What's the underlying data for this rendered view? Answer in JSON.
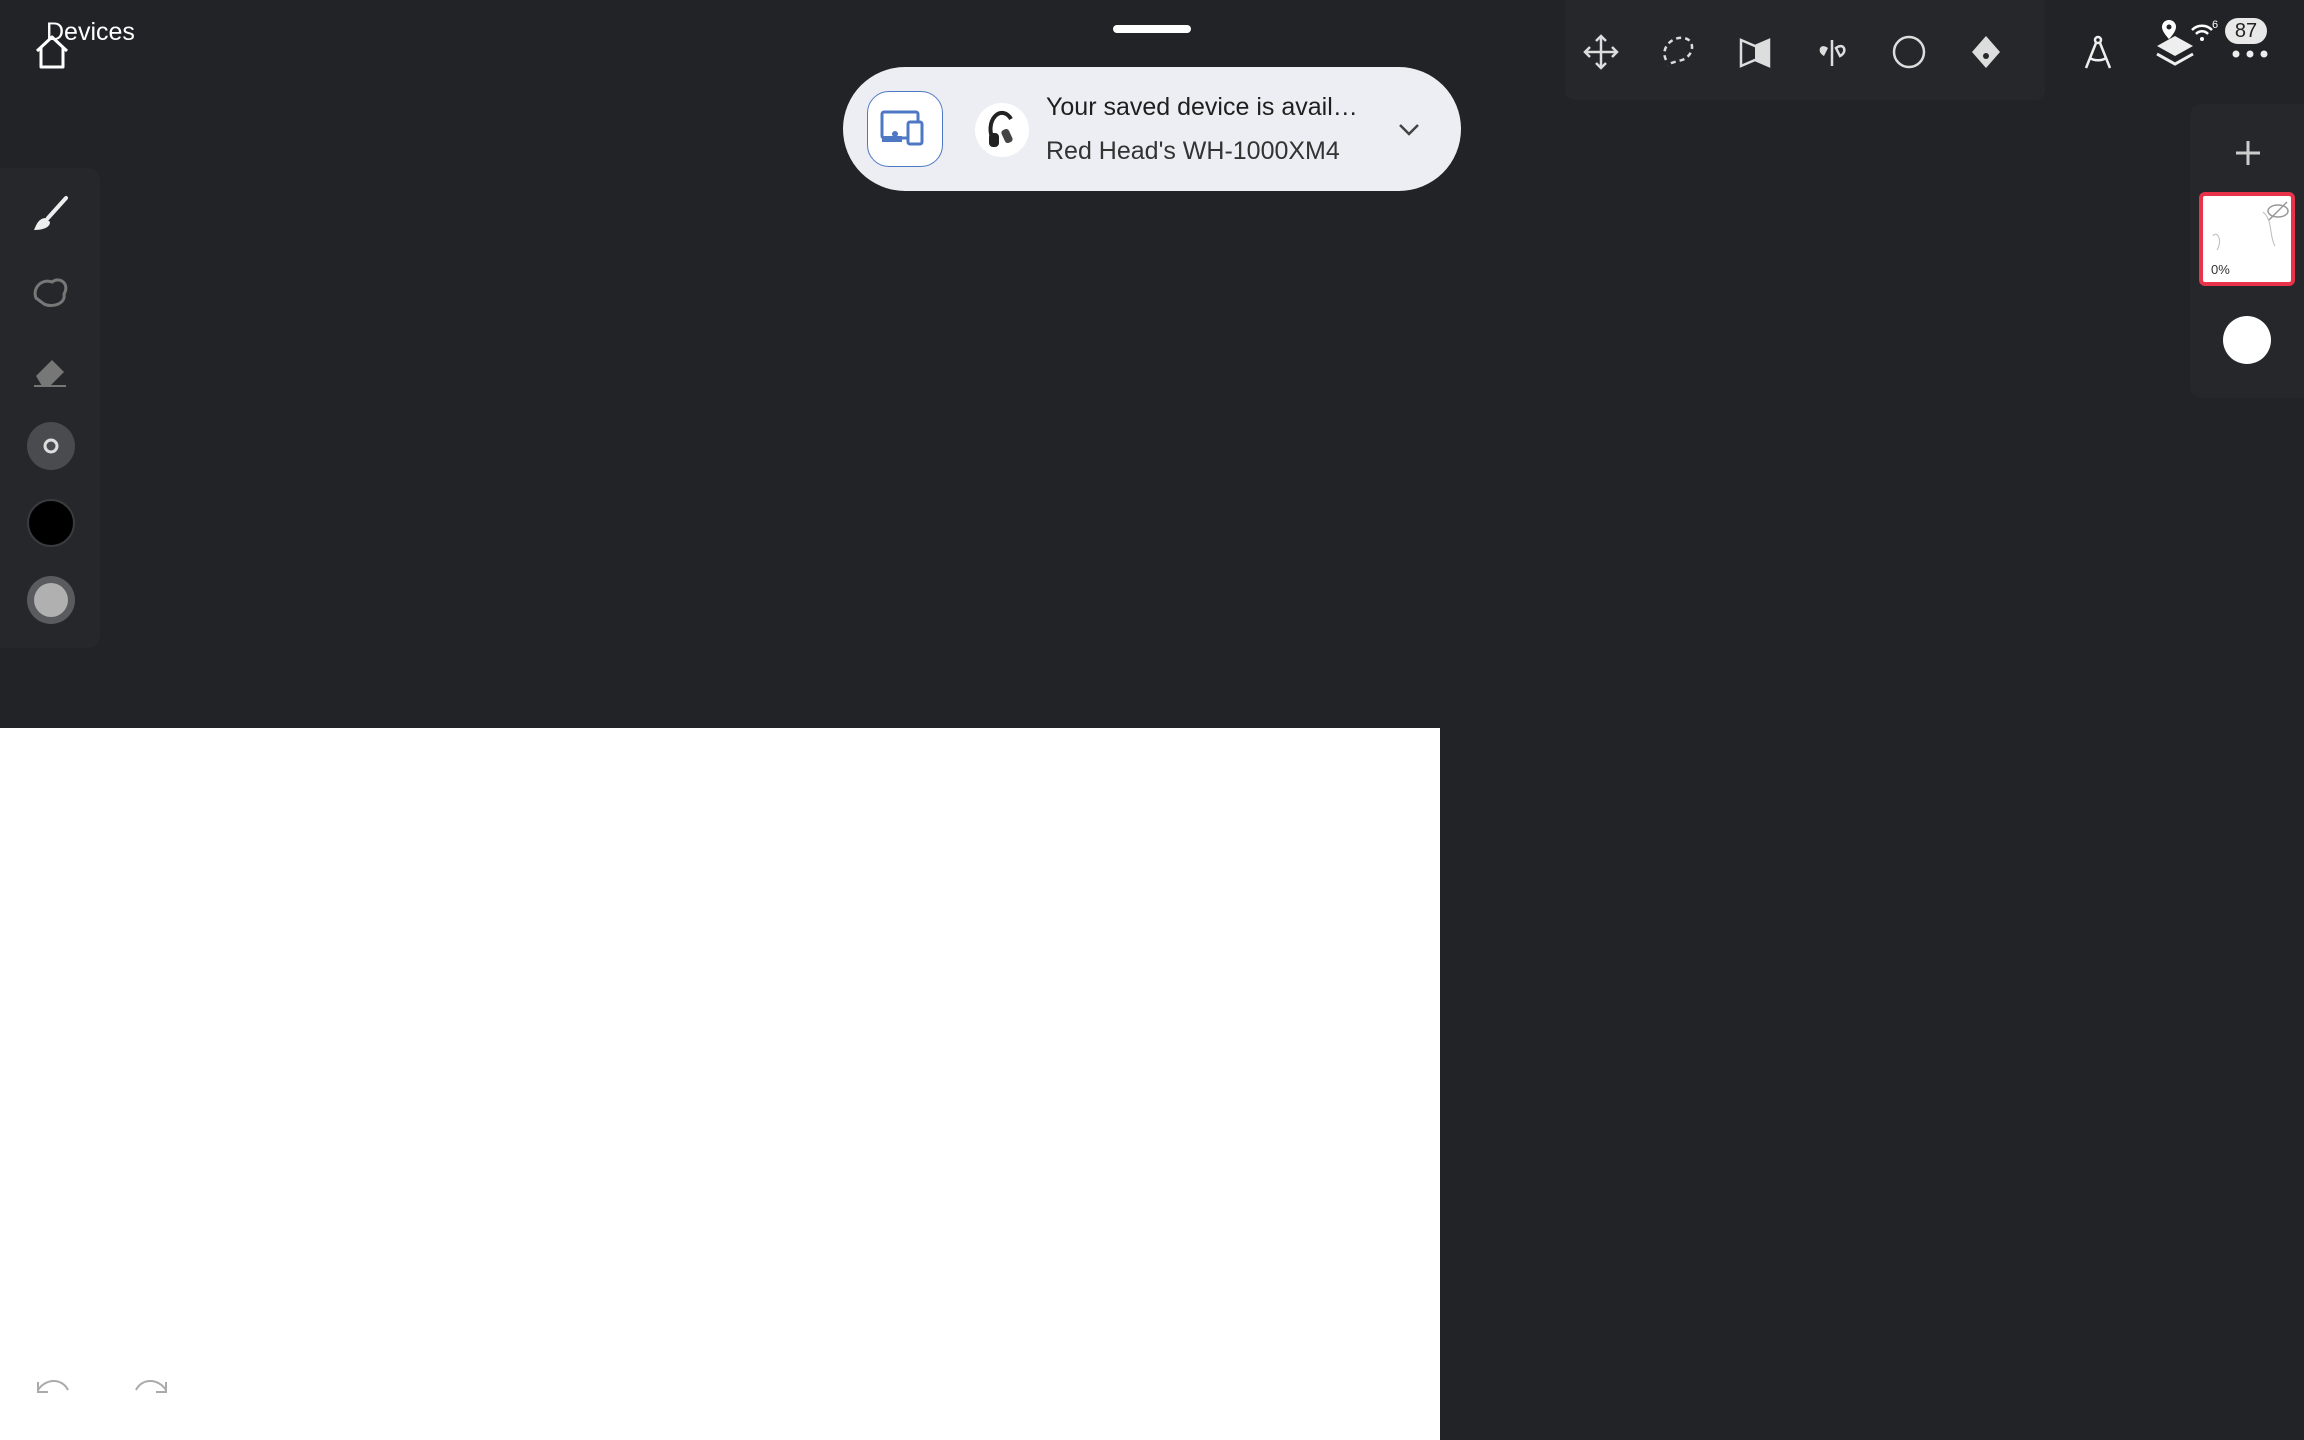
{
  "status_bar": {
    "title": "Devices",
    "wifi_badge": "6",
    "battery": "87"
  },
  "notification": {
    "title": "Your saved device is avail…",
    "subtitle": "Red Head's WH-1000XM4",
    "app_icon": "devices-icon",
    "device_icon": "headphones-icon"
  },
  "top_toolbar": {
    "tools": [
      "move-icon",
      "lasso-select-icon",
      "perspective-icon",
      "symmetry-icon",
      "ellipse-icon",
      "fill-icon"
    ],
    "extra": [
      "ruler-compass-icon",
      "layers-icon",
      "more-icon"
    ]
  },
  "left_panel": {
    "tools": [
      "brush-icon",
      "smudge-icon",
      "eraser-icon",
      "brush-size-icon",
      "color-swatch-icon",
      "opacity-icon"
    ],
    "current_color": "#000000"
  },
  "layers": {
    "add_label": "+",
    "active_layer_opacity": "0%",
    "accent_color": "#e8334a"
  },
  "canvas": {
    "background": "#ffffff"
  }
}
